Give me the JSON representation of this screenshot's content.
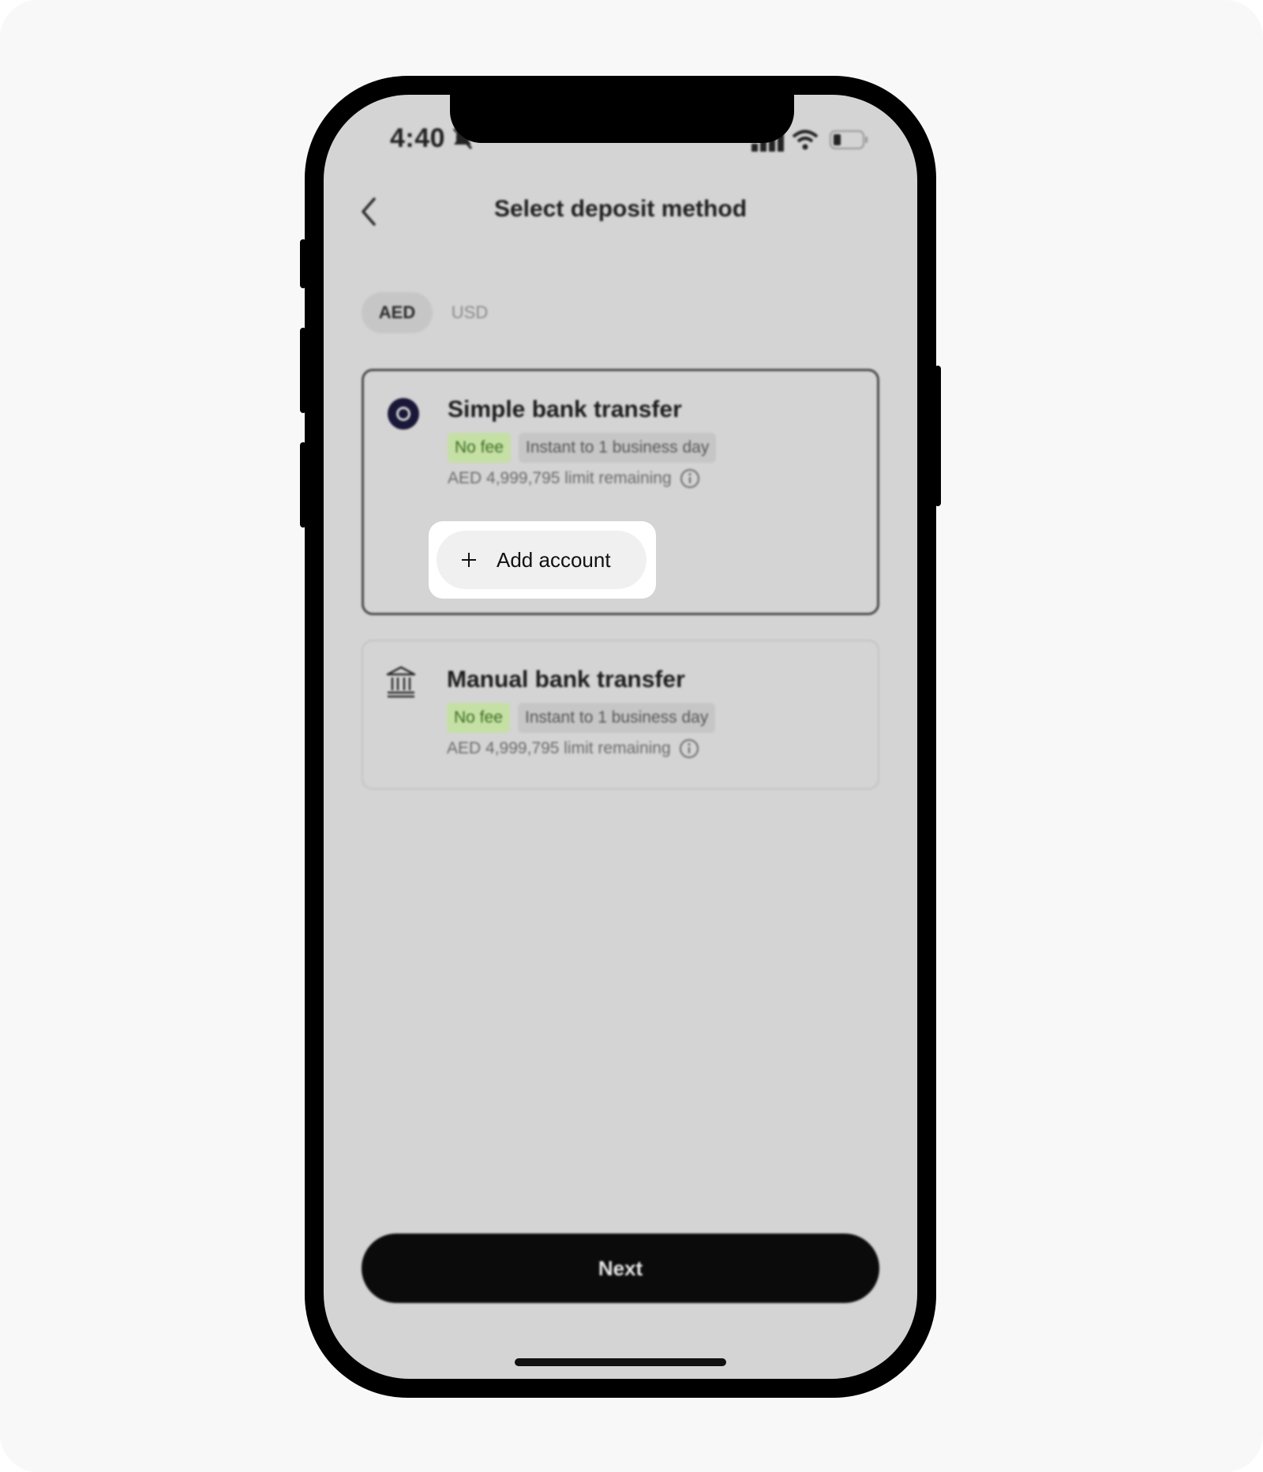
{
  "status_bar": {
    "time": "4:40",
    "icons": [
      "bell-off-icon",
      "cellular-signal-icon",
      "wifi-icon",
      "battery-icon"
    ]
  },
  "header": {
    "back_icon": "chevron-left-icon",
    "title": "Select deposit method"
  },
  "currency_tabs": [
    {
      "label": "AED",
      "selected": true
    },
    {
      "label": "USD",
      "selected": false
    }
  ],
  "methods": [
    {
      "title": "Simple bank transfer",
      "icon": "radio-selected-icon",
      "fee_tag": "No fee",
      "time_tag": "Instant to 1 business day",
      "limit_text": "AED 4,999,795 limit remaining",
      "selected": true
    },
    {
      "title": "Manual bank transfer",
      "icon": "bank-icon",
      "fee_tag": "No fee",
      "time_tag": "Instant to 1 business day",
      "limit_text": "AED 4,999,795 limit remaining",
      "selected": false
    }
  ],
  "add_account": {
    "label": "Add account",
    "icon": "plus-icon"
  },
  "next_button": {
    "label": "Next"
  },
  "colors": {
    "screen_bg": "#d4d4d4",
    "fee_tag_bg": "#c5e0a5",
    "fee_tag_text": "#3c6e20",
    "radio_fill": "#1a1838",
    "primary_button": "#0b0b0b",
    "highlight": "#ffffff"
  }
}
